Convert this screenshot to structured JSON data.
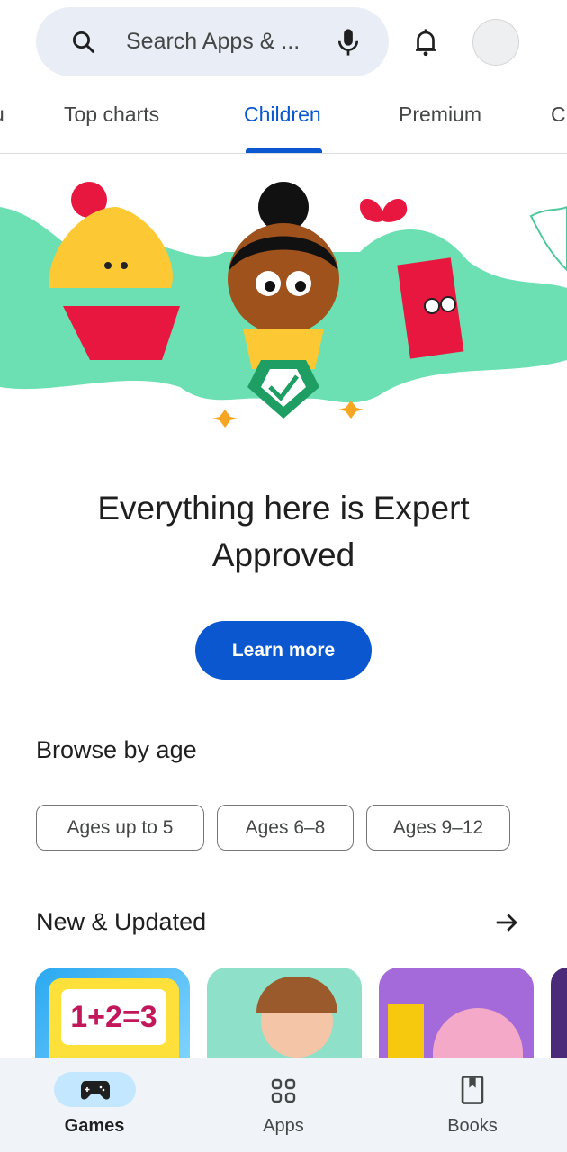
{
  "search": {
    "placeholder": "Search Apps & ...",
    "icon": "search-icon",
    "mic_icon": "mic-icon"
  },
  "header": {
    "bell_icon": "bell-icon",
    "avatar": "avatar"
  },
  "tabs": [
    {
      "label": "Top charts"
    },
    {
      "label": "Children",
      "active": true
    },
    {
      "label": "Premium"
    }
  ],
  "hero": {
    "title_line1": "Everything here is Expert",
    "title_line2": "Approved",
    "button": "Learn more"
  },
  "browse": {
    "title": "Browse by age",
    "chips": [
      "Ages up to 5",
      "Ages 6–8",
      "Ages 9–12"
    ]
  },
  "new_updated": {
    "title": "New & Updated",
    "arrow_icon": "arrow-right-icon"
  },
  "bottom_nav": [
    {
      "label": "Games",
      "icon": "gamepad-icon",
      "active": true
    },
    {
      "label": "Apps",
      "icon": "apps-grid-icon"
    },
    {
      "label": "Books",
      "icon": "book-icon"
    }
  ],
  "colors": {
    "accent": "#0b57d0",
    "search_bg": "#e9eef6",
    "nav_bg": "#f0f4f9",
    "active_pill": "#c2e7ff"
  }
}
